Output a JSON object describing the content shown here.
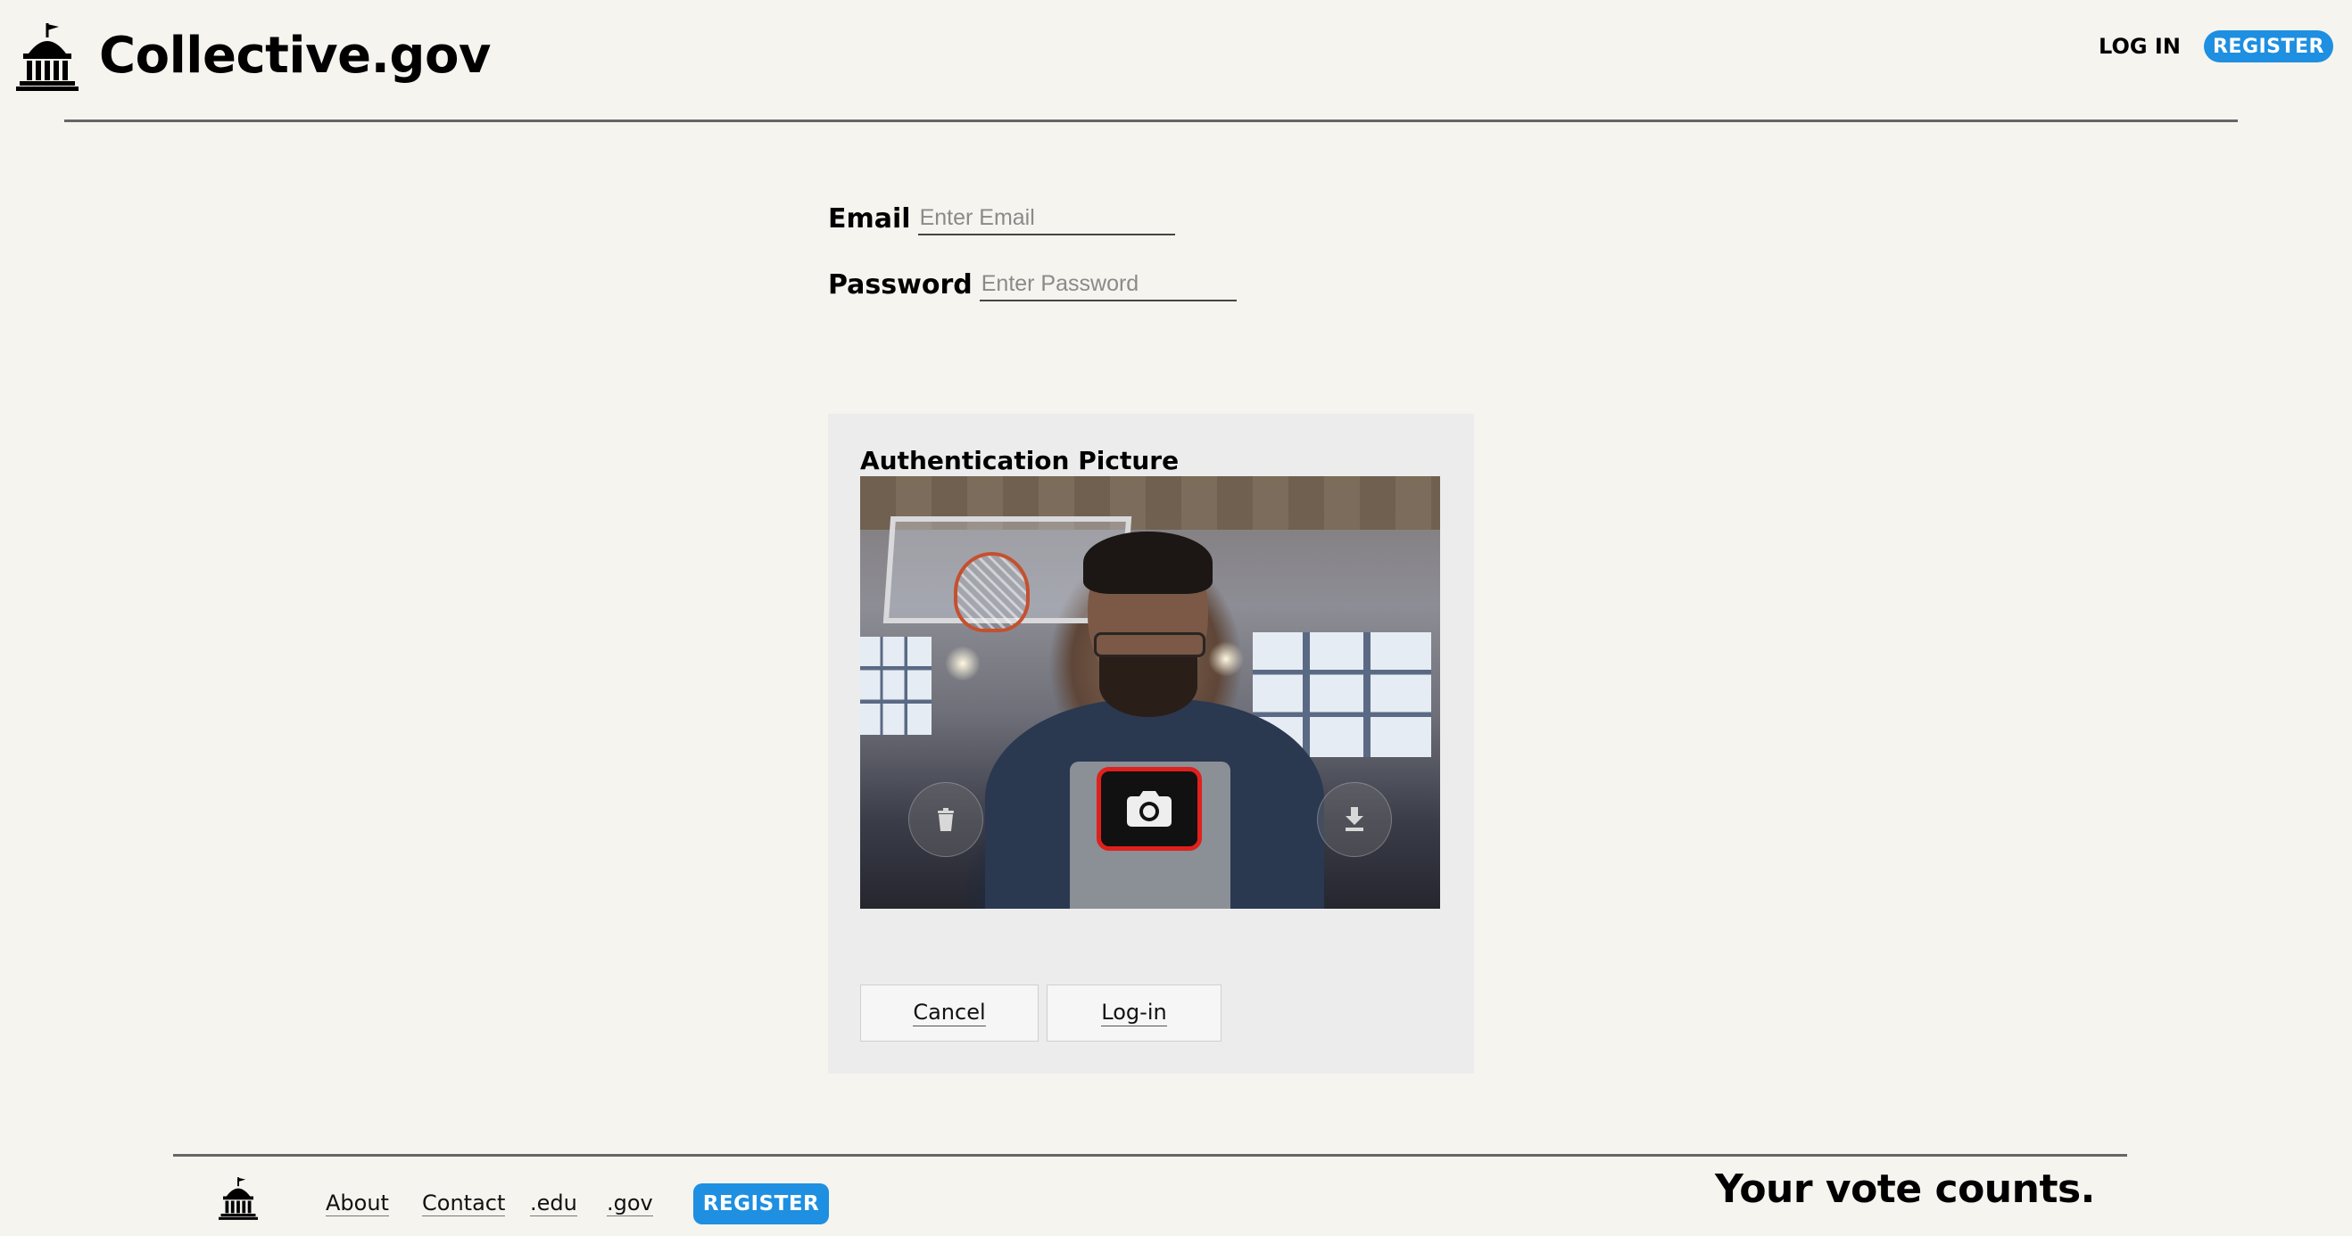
{
  "header": {
    "brand": "Collective.gov",
    "login_label": "LOG IN",
    "register_label": "REGISTER",
    "logo_icon": "capitol-building-icon"
  },
  "form": {
    "email_label": "Email",
    "email_placeholder": "Enter Email",
    "email_value": "",
    "password_label": "Password",
    "password_placeholder": "Enter Password",
    "password_value": ""
  },
  "auth": {
    "title": "Authentication Picture",
    "controls": {
      "left_icon": "trash-icon",
      "center_icon": "camera-icon",
      "right_icon": "download-icon"
    },
    "highlight_color": "#e0201c",
    "cancel_label": "Cancel",
    "login_label": "Log-in"
  },
  "footer": {
    "logo_icon": "capitol-building-icon",
    "links": [
      "About",
      "Contact",
      ".edu",
      ".gov"
    ],
    "register_label": "REGISTER",
    "tagline": "Your vote counts."
  },
  "colors": {
    "background": "#f5f4ef",
    "accent": "#1e8fe1",
    "panel": "#ececec"
  }
}
